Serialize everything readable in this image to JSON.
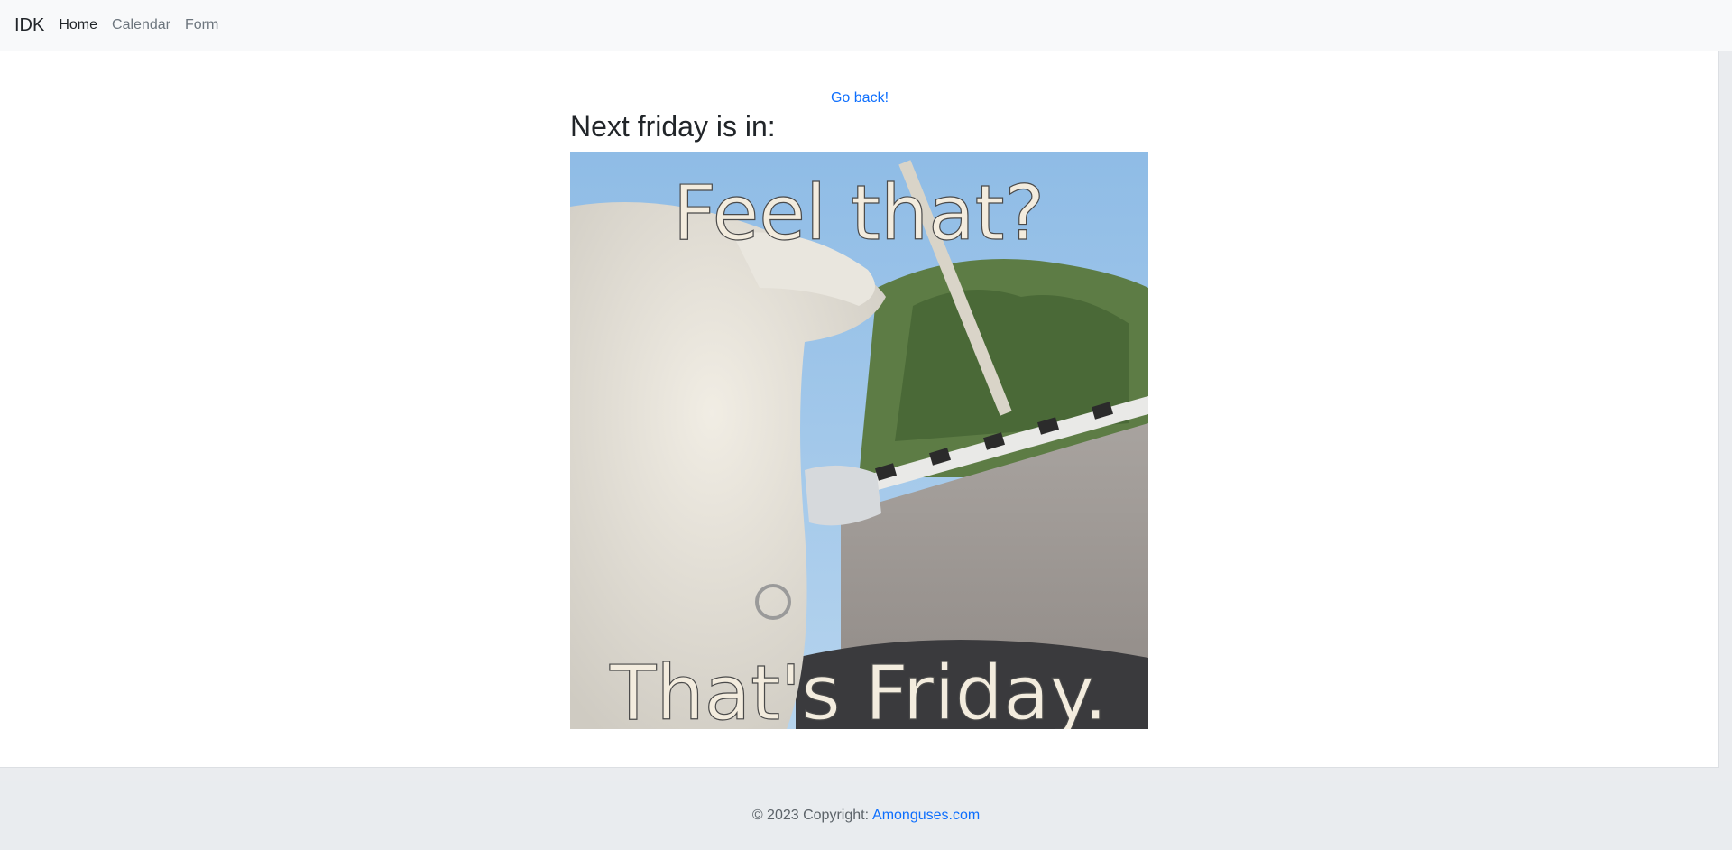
{
  "navbar": {
    "brand": "IDK",
    "links": [
      {
        "label": "Home",
        "active": true
      },
      {
        "label": "Calendar",
        "active": false
      },
      {
        "label": "Form",
        "active": false
      }
    ]
  },
  "main": {
    "go_back_label": "Go back!",
    "heading": "Next friday is in:",
    "meme": {
      "top_caption": "Feel that?",
      "bottom_caption": "That's Friday."
    }
  },
  "footer": {
    "copyright": "© 2023 Copyright:",
    "link_label": "Amonguses.com"
  }
}
